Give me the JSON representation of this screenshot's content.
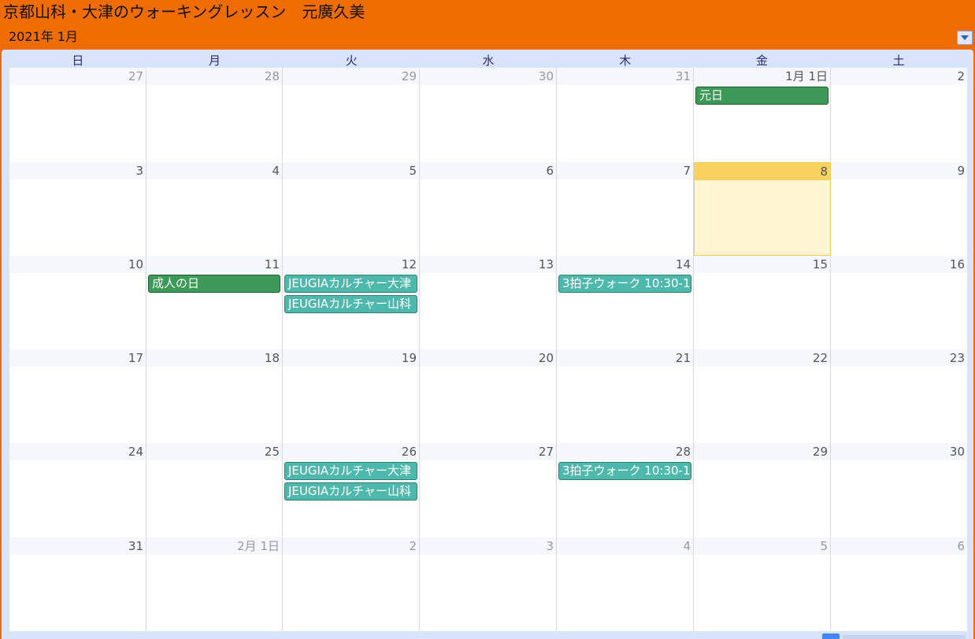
{
  "calendar": {
    "title": "京都山科・大津のウォーキングレッスン　元廣久美",
    "month_label": "2021年 1月",
    "weekdays": [
      "日",
      "月",
      "火",
      "水",
      "木",
      "金",
      "土"
    ],
    "weeks": [
      {
        "days": [
          {
            "label": "27",
            "other_month": true
          },
          {
            "label": "28",
            "other_month": true
          },
          {
            "label": "29",
            "other_month": true
          },
          {
            "label": "30",
            "other_month": true
          },
          {
            "label": "31",
            "other_month": true
          },
          {
            "label": "1月 1日",
            "events": [
              {
                "title": "元日",
                "type": "holiday"
              }
            ]
          },
          {
            "label": "2"
          }
        ]
      },
      {
        "days": [
          {
            "label": "3"
          },
          {
            "label": "4"
          },
          {
            "label": "5"
          },
          {
            "label": "6"
          },
          {
            "label": "7"
          },
          {
            "label": "8",
            "today": true
          },
          {
            "label": "9"
          }
        ]
      },
      {
        "days": [
          {
            "label": "10"
          },
          {
            "label": "11",
            "events": [
              {
                "title": "成人の日",
                "type": "holiday"
              }
            ]
          },
          {
            "label": "12",
            "events": [
              {
                "title": "JEUGIAカルチャー大津",
                "type": "lesson"
              },
              {
                "title": "JEUGIAカルチャー山科",
                "type": "lesson"
              }
            ]
          },
          {
            "label": "13"
          },
          {
            "label": "14",
            "events": [
              {
                "title": "3拍子ウォーク 10:30-1",
                "type": "lesson"
              }
            ]
          },
          {
            "label": "15"
          },
          {
            "label": "16"
          }
        ]
      },
      {
        "days": [
          {
            "label": "17"
          },
          {
            "label": "18"
          },
          {
            "label": "19"
          },
          {
            "label": "20"
          },
          {
            "label": "21"
          },
          {
            "label": "22"
          },
          {
            "label": "23"
          }
        ]
      },
      {
        "days": [
          {
            "label": "24"
          },
          {
            "label": "25"
          },
          {
            "label": "26",
            "events": [
              {
                "title": "JEUGIAカルチャー大津",
                "type": "lesson"
              },
              {
                "title": "JEUGIAカルチャー山科",
                "type": "lesson"
              }
            ]
          },
          {
            "label": "27"
          },
          {
            "label": "28",
            "events": [
              {
                "title": "3拍子ウォーク 10:30-1",
                "type": "lesson"
              }
            ]
          },
          {
            "label": "29"
          },
          {
            "label": "30"
          }
        ]
      },
      {
        "days": [
          {
            "label": "31"
          },
          {
            "label": "2月 1日",
            "other_month": true
          },
          {
            "label": "2",
            "other_month": true
          },
          {
            "label": "3",
            "other_month": true
          },
          {
            "label": "4",
            "other_month": true
          },
          {
            "label": "5",
            "other_month": true
          },
          {
            "label": "6",
            "other_month": true
          }
        ]
      }
    ]
  },
  "colors": {
    "header_bg": "#ef6c00",
    "holiday_event": "#3d9957",
    "lesson_event": "#4fb8ad",
    "today_bg": "#fef5d3",
    "today_head": "#f9d160"
  },
  "icons": {
    "dropdown": "chevron-down-icon"
  }
}
